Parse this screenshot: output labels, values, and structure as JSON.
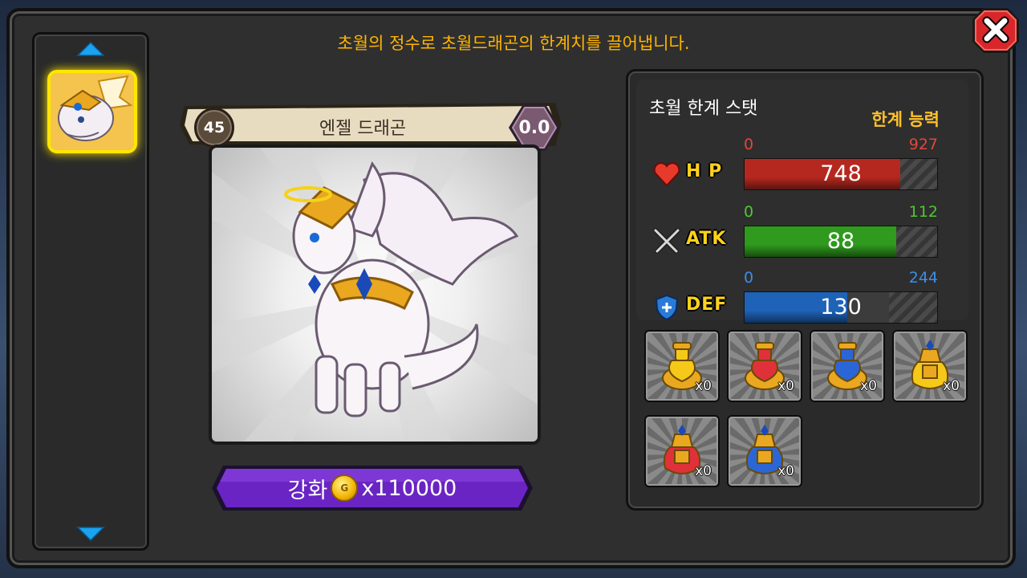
{
  "header": {
    "description": "초월의 정수로 초월드래곤의 한계치를 끌어냅니다."
  },
  "close_button": {
    "icon": "close-icon"
  },
  "dragon_list": {
    "selected_index": 0
  },
  "dragon": {
    "level": "45",
    "name": "엔젤 드래곤",
    "rating": "0.0"
  },
  "enhance": {
    "label": "강화",
    "cost": "x110000",
    "currency_icon": "gold-coin-icon"
  },
  "stats_panel": {
    "title": "초월 한계 스탯",
    "limit_label": "한계 능력",
    "stats": [
      {
        "name": "H P",
        "icon": "heart-icon",
        "min": "0",
        "max": "927",
        "value": "748",
        "fraction": 0.807,
        "color": "#b5281f",
        "range_color": "#e0473c"
      },
      {
        "name": "ATK",
        "icon": "crossed-swords-icon",
        "min": "0",
        "max": "112",
        "value": "88",
        "fraction": 0.786,
        "color": "#2f9a1e",
        "range_color": "#4fc832"
      },
      {
        "name": "DEF",
        "icon": "shield-icon",
        "min": "0",
        "max": "244",
        "value": "130",
        "fraction": 0.533,
        "color": "#1f63b8",
        "range_color": "#3d8ee6"
      }
    ]
  },
  "essence_items": [
    {
      "name": "yellow-essence-icon",
      "count": "x0",
      "color": "#f5c81a"
    },
    {
      "name": "red-essence-icon",
      "count": "x0",
      "color": "#e0303a"
    },
    {
      "name": "blue-essence-icon",
      "count": "x0",
      "color": "#2a66d6"
    },
    {
      "name": "large-yellow-essence-icon",
      "count": "x0",
      "color": "#f5c81a"
    },
    {
      "name": "large-red-essence-icon",
      "count": "x0",
      "color": "#e0303a"
    },
    {
      "name": "large-blue-essence-icon",
      "count": "x0",
      "color": "#2a66d6"
    }
  ]
}
